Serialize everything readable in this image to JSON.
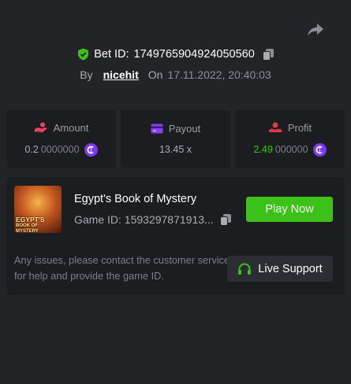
{
  "bet": {
    "id_label": "Bet ID:",
    "id_value": "1749765904924050560",
    "by_label": "By",
    "user": "nicehit",
    "on_label": "On",
    "date": "17.11.2022, 20:40:03"
  },
  "stats": {
    "amount": {
      "label": "Amount",
      "value_main": "0.2",
      "value_rest": "0000000"
    },
    "payout": {
      "label": "Payout",
      "value": "13.45 x"
    },
    "profit": {
      "label": "Profit",
      "value_main": "2.49",
      "value_rest": "000000"
    }
  },
  "game": {
    "thumb_line1": "EGYPT'S",
    "thumb_line2": "BOOK OF MYSTERY",
    "title": "Egypt's Book of Mystery",
    "id_text": "Game ID: 1593297871913...",
    "play_label": "Play Now"
  },
  "support": {
    "text": "Any issues, please contact the customer service for help and provide the game ID.",
    "button_label": "Live Support"
  },
  "colors": {
    "background": "#232428",
    "card": "#1c1d21",
    "accent_green": "#3bc117",
    "coin_purple": "#7c3aed"
  },
  "icons": {
    "share": "share-arrow-icon",
    "verified": "shield-check-icon",
    "copy": "copy-icon",
    "amount": "hand-coins-icon",
    "payout": "card-icon",
    "profit": "profit-icon",
    "coin": "coin-icon",
    "support": "headset-icon"
  }
}
